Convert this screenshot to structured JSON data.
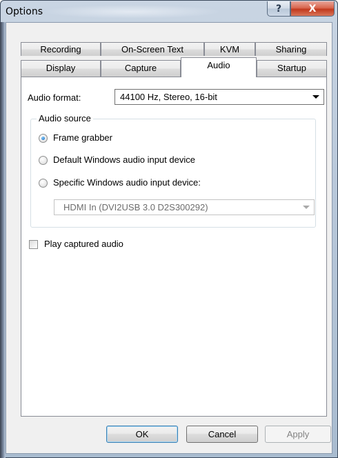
{
  "window": {
    "title": "Options",
    "help_glyph": "?",
    "close_glyph": "X"
  },
  "tabs": {
    "row1": [
      {
        "label": "Recording"
      },
      {
        "label": "On-Screen Text"
      },
      {
        "label": "KVM"
      },
      {
        "label": "Sharing"
      }
    ],
    "row2": [
      {
        "label": "Display"
      },
      {
        "label": "Capture"
      },
      {
        "label": "Audio",
        "active": true
      },
      {
        "label": "Startup"
      }
    ]
  },
  "audio": {
    "format_label": "Audio format:",
    "format_value": "44100 Hz, Stereo, 16-bit",
    "source_group": "Audio source",
    "radio_frame_grabber": "Frame grabber",
    "radio_default_windows": "Default Windows audio input device",
    "radio_specific_windows": "Specific Windows audio input device:",
    "selected_source": "Frame grabber",
    "device_value": "HDMI In (DVI2USB 3.0 D2S300292)",
    "play_captured_label": "Play captured audio",
    "play_captured_checked": false
  },
  "buttons": {
    "ok": "OK",
    "cancel": "Cancel",
    "apply": "Apply"
  }
}
